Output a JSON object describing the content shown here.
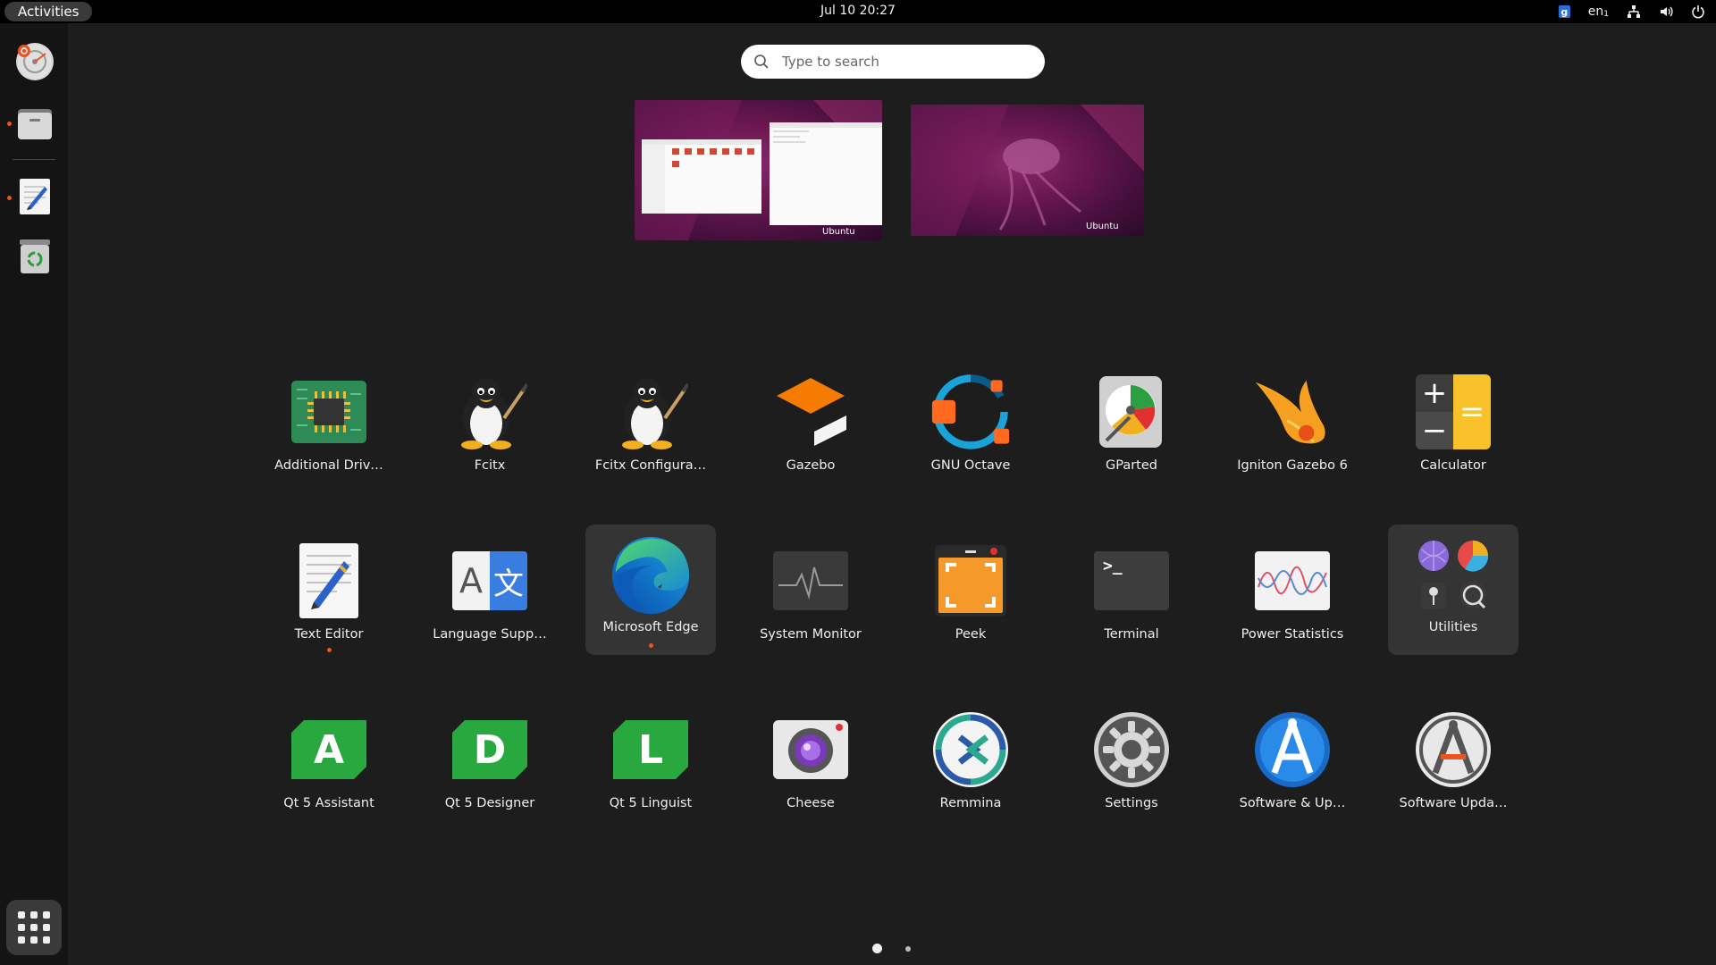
{
  "topbar": {
    "activities": "Activities",
    "clock": "Jul 10  20:27",
    "tray": {
      "badge": "g",
      "keyboard": "en",
      "keyboard_suffix": "1"
    }
  },
  "dock": {
    "items": [
      {
        "name": "Ubuntu Installer"
      },
      {
        "name": "Files",
        "running": true
      },
      {
        "name": "Text Editor",
        "running": true
      },
      {
        "name": "Trash"
      }
    ]
  },
  "search": {
    "placeholder": "Type to search"
  },
  "workspaces": [
    {
      "logo": "Ubuntu"
    },
    {
      "logo": "Ubuntu"
    }
  ],
  "apps": [
    {
      "label": "Additional Driv…",
      "icon": "chip-icon"
    },
    {
      "label": "Fcitx",
      "icon": "penguin-icon"
    },
    {
      "label": "Fcitx Configura…",
      "icon": "penguin-icon"
    },
    {
      "label": "Gazebo",
      "icon": "gazebo-icon"
    },
    {
      "label": "GNU Octave",
      "icon": "octave-icon"
    },
    {
      "label": "GParted",
      "icon": "gparted-icon"
    },
    {
      "label": "Igniton Gazebo 6",
      "icon": "ignition-icon"
    },
    {
      "label": "Calculator",
      "icon": "calculator-icon"
    },
    {
      "label": "Text Editor",
      "icon": "text-editor-icon",
      "running": true
    },
    {
      "label": "Language Supp…",
      "icon": "language-icon"
    },
    {
      "label": "Microsoft Edge",
      "icon": "edge-icon",
      "running": true,
      "highlighted": true
    },
    {
      "label": "System Monitor",
      "icon": "system-monitor-icon"
    },
    {
      "label": "Peek",
      "icon": "peek-icon"
    },
    {
      "label": "Terminal",
      "icon": "terminal-icon"
    },
    {
      "label": "Power Statistics",
      "icon": "power-stats-icon"
    },
    {
      "label": "Utilities",
      "icon": "folder-grid-icon",
      "highlighted": true
    },
    {
      "label": "Qt 5 Assistant",
      "icon": "qt-assistant-icon",
      "glyph": "A"
    },
    {
      "label": "Qt 5 Designer",
      "icon": "qt-designer-icon",
      "glyph": "D"
    },
    {
      "label": "Qt 5 Linguist",
      "icon": "qt-linguist-icon",
      "glyph": "L"
    },
    {
      "label": "Cheese",
      "icon": "cheese-icon"
    },
    {
      "label": "Remmina",
      "icon": "remmina-icon"
    },
    {
      "label": "Settings",
      "icon": "settings-icon"
    },
    {
      "label": "Software & Up…",
      "icon": "software-icon"
    },
    {
      "label": "Software Upda…",
      "icon": "software-updater-icon"
    }
  ],
  "language_icon": {
    "latin": "A",
    "cjk": "文"
  },
  "terminal_icon": {
    "prompt": ">_"
  },
  "calculator_icon": {
    "plus": "+",
    "minus": "−",
    "equals": "="
  },
  "pager": {
    "pages": 2,
    "current": 1
  },
  "colors": {
    "accent": "#e95420",
    "background": "#1d1d1d",
    "topbar": "#000000"
  }
}
